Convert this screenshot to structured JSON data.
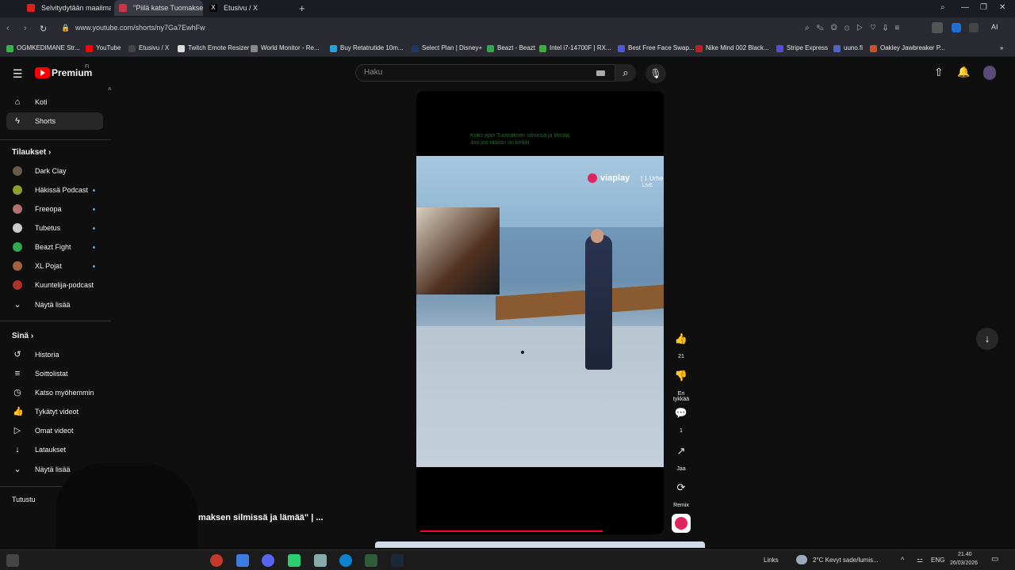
{
  "browser": {
    "tabs": [
      {
        "label": "Selvitydytään maailman va",
        "color": "#e02020"
      },
      {
        "label": "\"Piilä katse Tuomakse",
        "color": "#cc3344"
      },
      {
        "label": "Etusivu / X",
        "color": "#000000"
      }
    ],
    "new_tab": "+",
    "url": "www.youtube.com/shorts/ny7Ga7EwhFw"
  },
  "bookmarks": [
    {
      "label": "OGMKEDIMANE Str...",
      "color": "#35b24a"
    },
    {
      "label": "YouTube",
      "color": "#ff0000"
    },
    {
      "label": "Etusivu / X",
      "color": "#444444"
    },
    {
      "label": "Twitch Emote Resizer",
      "color": "#dddddd"
    },
    {
      "label": "World Monitor - Re...",
      "color": "#888888"
    },
    {
      "label": "Buy Retatrutide 10m...",
      "color": "#2aa0d8"
    },
    {
      "label": "Select Plan | Disney+",
      "color": "#1a3a6a"
    },
    {
      "label": "Beazt - Beazt",
      "color": "#2fa84f"
    },
    {
      "label": "Intel i7-14700F | RX...",
      "color": "#3fae3f"
    },
    {
      "label": "Best Free Face Swap...",
      "color": "#4a5ad8"
    },
    {
      "label": "Nike Mind 002 Black...",
      "color": "#c02020"
    },
    {
      "label": "Stripe Express",
      "color": "#5a4ad8"
    },
    {
      "label": "uuno.fi",
      "color": "#4a66c8"
    },
    {
      "label": "Oakley Jawbreaker P...",
      "color": "#d05020"
    }
  ],
  "youtube": {
    "logo_text": "Premium",
    "logo_sup": "FI",
    "search_placeholder": "Haku",
    "sidebar": {
      "main": [
        {
          "label": "Koti",
          "icon": "⌂"
        },
        {
          "label": "Shorts",
          "icon": "▶"
        }
      ],
      "subs_header": "Tilaukset",
      "subs": [
        {
          "label": "Dark Clay",
          "color": "#6b5a4a"
        },
        {
          "label": "Häkissä Podcast",
          "color": "#8ca030"
        },
        {
          "label": "Freeopa",
          "color": "#b07070"
        },
        {
          "label": "Tubetus",
          "color": "#cccccc"
        },
        {
          "label": "Beazt Fight",
          "color": "#2fa84f"
        },
        {
          "label": "XL Pojat",
          "color": "#a06040"
        },
        {
          "label": "Kuuntelija-podcast",
          "color": "#b03030"
        }
      ],
      "show_more": "Näytä lisää",
      "you_header": "Sinä",
      "you": [
        {
          "label": "Historia",
          "icon": "↺"
        },
        {
          "label": "Soittolistat",
          "icon": "≡"
        },
        {
          "label": "Katso myöhemmin",
          "icon": "◷"
        },
        {
          "label": "Tykätyt videot",
          "icon": "👍"
        },
        {
          "label": "Omat videot",
          "icon": "▷"
        },
        {
          "label": "Lataukset",
          "icon": "↓"
        }
      ],
      "show_more_2": "Näytä lisää",
      "explore_header": "Tutustu"
    },
    "video": {
      "caption_line1": "Koko ajan Tuomaksen silmissä ja lämää.",
      "caption_line2": "Joo joo tääiiän on keikki",
      "brand": "viaplay",
      "brand_suffix": "| 1 Urhe",
      "live": "LIVE",
      "title_fragment": "maksen silmissä ja lämää\" | ..."
    },
    "actions": [
      {
        "icon": "👍",
        "label": "21"
      },
      {
        "icon": "👎",
        "label": "En tykkää"
      },
      {
        "icon": "💬",
        "label": "1"
      },
      {
        "icon": "↗",
        "label": "Jaa"
      },
      {
        "icon": "⟳",
        "label": "Remix"
      }
    ]
  },
  "taskbar": {
    "links": "Links",
    "weather": "2°C  Kevyt sade/lumis...",
    "lang": "ENG",
    "time": "21.40",
    "date": "26/03/2026"
  }
}
